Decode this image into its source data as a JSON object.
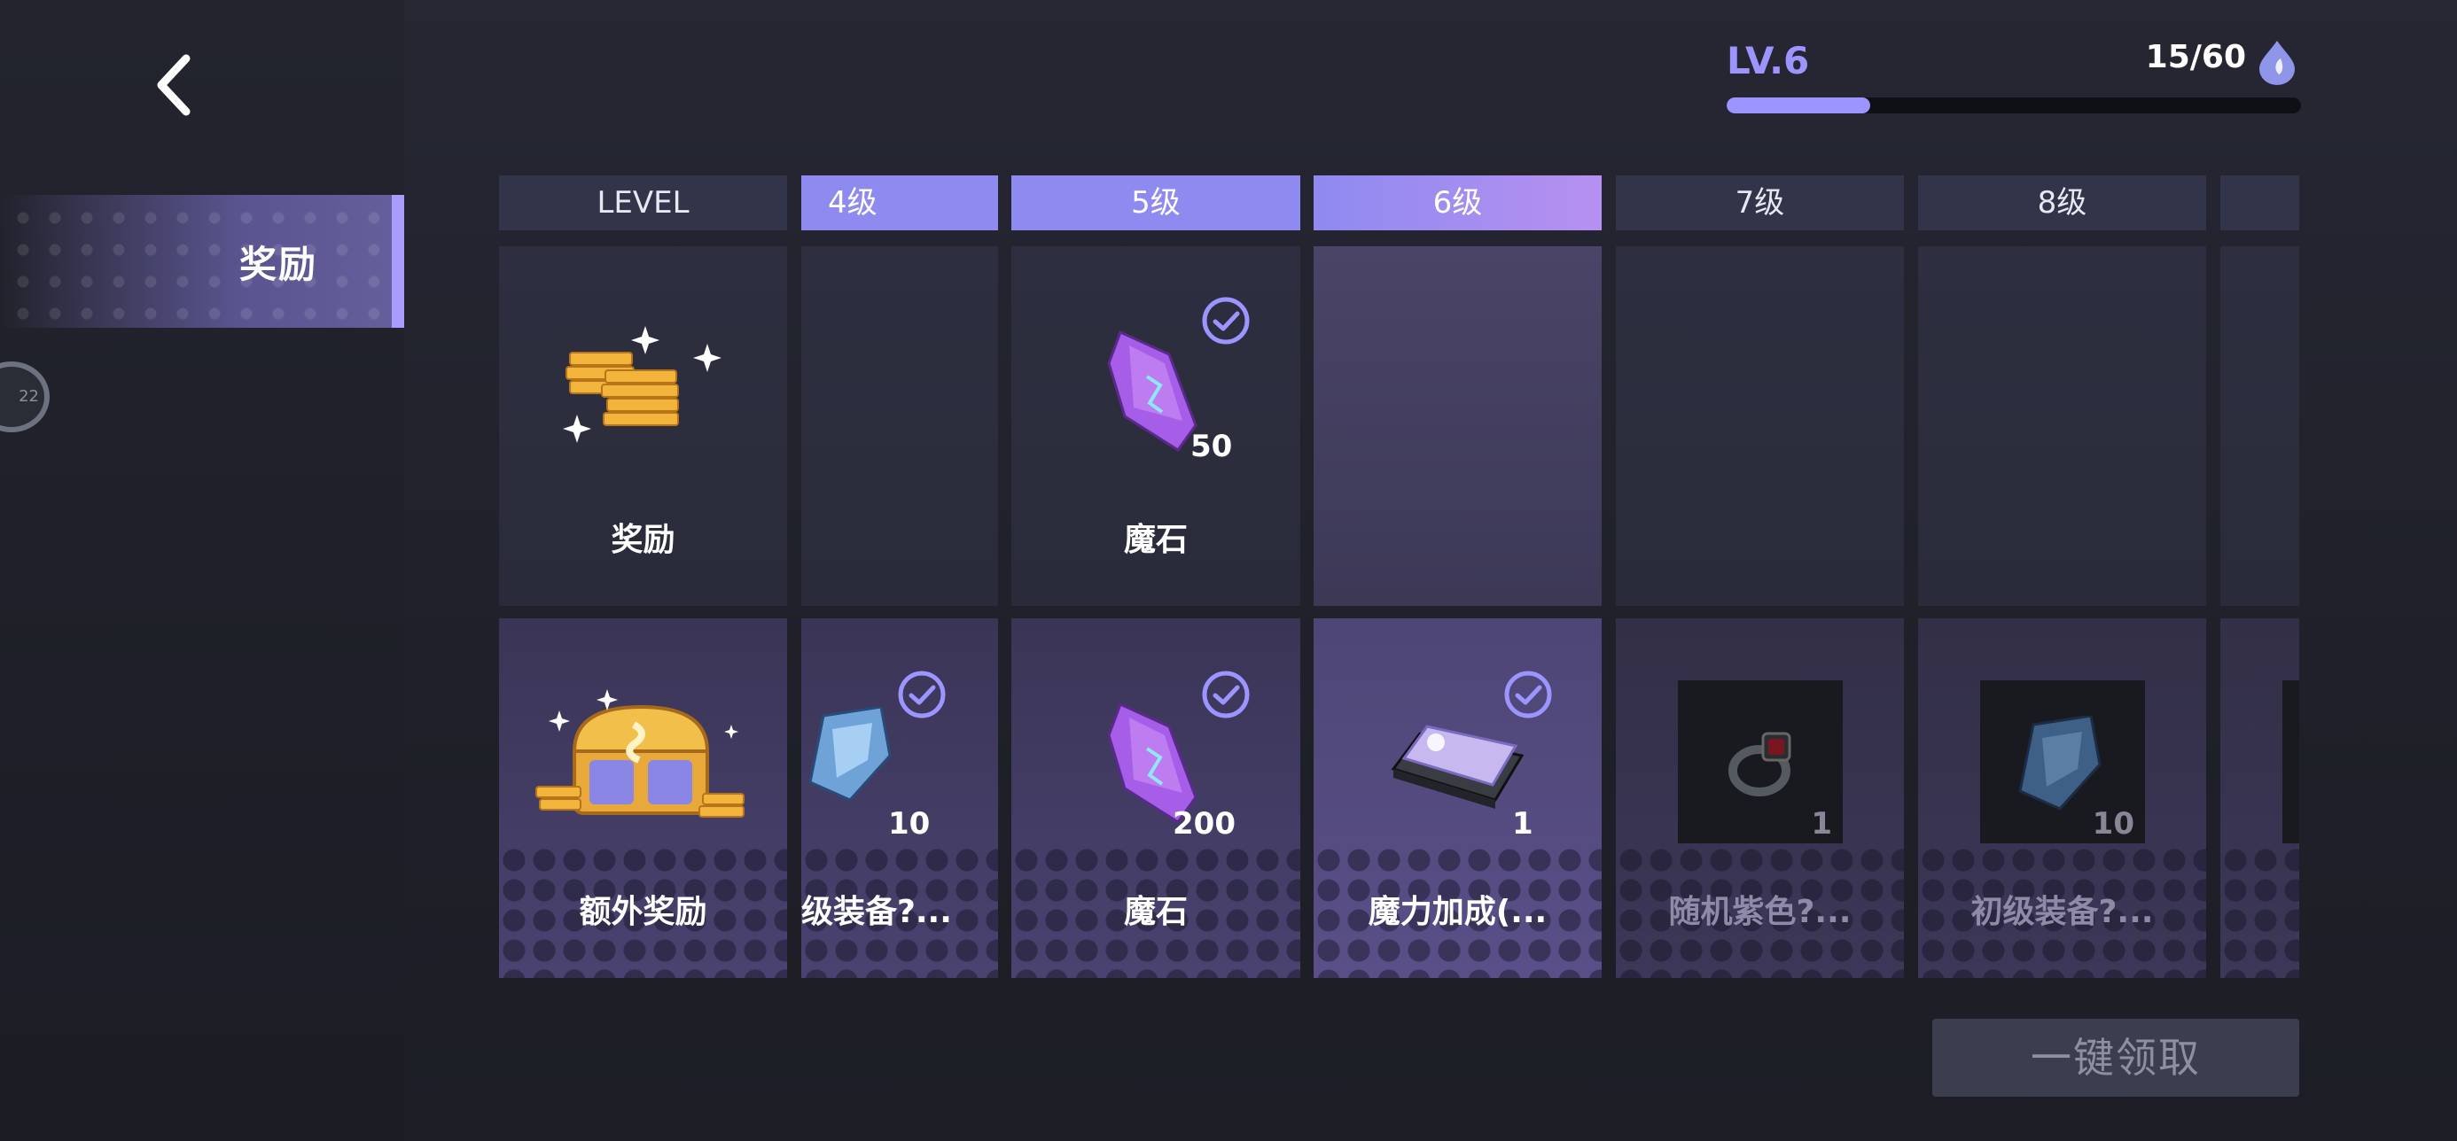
{
  "nav": {
    "tab_label": "奖励",
    "avatar_text": "22"
  },
  "level": {
    "label": "LV.6",
    "exp_text": "15/60",
    "exp_progress": 0.25
  },
  "columns": {
    "level_header": "LEVEL",
    "headers": [
      "4级",
      "5级",
      "6级",
      "7级",
      "8级"
    ]
  },
  "rows": {
    "free_label": "奖励",
    "extra_label": "额外奖励"
  },
  "rewards": {
    "free": [
      {
        "level": "4级",
        "name": "",
        "count": ""
      },
      {
        "level": "5级",
        "name": "魔石",
        "count": "50",
        "claimed": true,
        "icon": "purple-crystal-icon"
      },
      {
        "level": "6级",
        "name": "",
        "count": ""
      },
      {
        "level": "7级",
        "name": "",
        "count": ""
      },
      {
        "level": "8级",
        "name": "",
        "count": ""
      }
    ],
    "extra": [
      {
        "level": "4级",
        "name": "级装备?...",
        "count": "10",
        "claimed": true,
        "icon": "blue-crystal-icon"
      },
      {
        "level": "5级",
        "name": "魔石",
        "count": "200",
        "claimed": true,
        "icon": "purple-crystal-icon"
      },
      {
        "level": "6级",
        "name": "魔力加成(...",
        "count": "1",
        "claimed": true,
        "icon": "magic-card-icon"
      },
      {
        "level": "7级",
        "name": "随机紫色?...",
        "count": "1",
        "claimed": false,
        "icon": "ring-icon"
      },
      {
        "level": "8级",
        "name": "初级装备?...",
        "count": "10",
        "claimed": false,
        "icon": "blue-crystal-icon"
      }
    ]
  },
  "actions": {
    "claim_all": "一键领取"
  },
  "colors": {
    "accent": "#9c94ff",
    "header_active": "#8f8af0",
    "background": "#1b1c24"
  }
}
